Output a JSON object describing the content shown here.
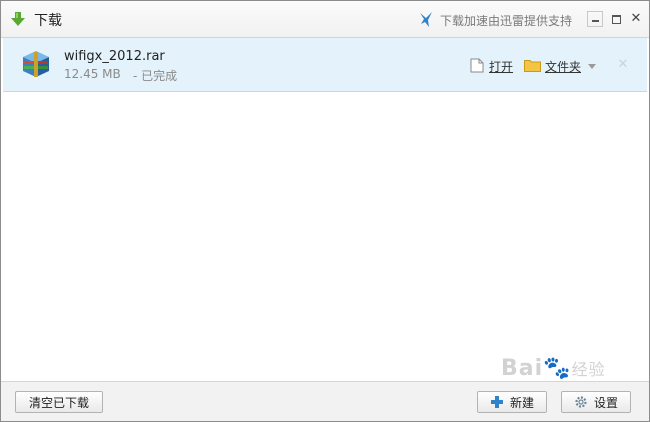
{
  "window": {
    "title": "下载",
    "accel_text": "下载加速由迅雷提供支持"
  },
  "download": {
    "file_name": "wifigx_2012.rar",
    "size": "12.45 MB",
    "status": "- 已完成",
    "open_label": "打开",
    "folder_label": "文件夹"
  },
  "footer": {
    "clear_label": "清空已下载",
    "new_label": "新建",
    "settings_label": "设置"
  },
  "watermark": {
    "text": "Bai",
    "sub": "经验"
  },
  "colors": {
    "item_bg": "#e3f2fb",
    "accent_green": "#5aa832",
    "link_blue": "#2f84c9"
  },
  "icons": [
    "download-arrow-icon",
    "xunlei-bird-icon",
    "rar-archive-icon",
    "document-icon",
    "folder-icon",
    "plus-icon",
    "gear-icon"
  ]
}
